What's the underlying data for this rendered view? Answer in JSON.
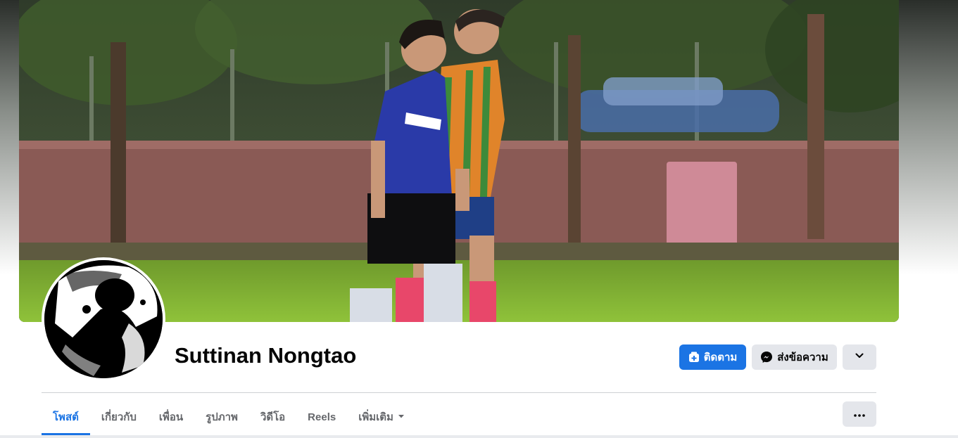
{
  "profile": {
    "name": "Suttinan Nongtao"
  },
  "actions": {
    "follow_label": "ติดตาม",
    "message_label": "ส่งข้อความ"
  },
  "tabs": [
    {
      "label": "โพสต์",
      "active": true
    },
    {
      "label": "เกี่ยวกับ",
      "active": false
    },
    {
      "label": "เพื่อน",
      "active": false
    },
    {
      "label": "รูปภาพ",
      "active": false
    },
    {
      "label": "วิดีโอ",
      "active": false
    },
    {
      "label": "Reels",
      "active": false
    },
    {
      "label": "เพิ่มเติม",
      "active": false
    }
  ],
  "icons": {
    "follow": "add-friend-icon",
    "message": "messenger-icon",
    "dropdown": "chevron-down-icon",
    "more_tab": "caret-down-icon",
    "overflow": "more-dots-icon"
  },
  "colors": {
    "accent": "#1b74e4",
    "button_gray": "#e4e6eb",
    "text_secondary": "#65676b"
  }
}
